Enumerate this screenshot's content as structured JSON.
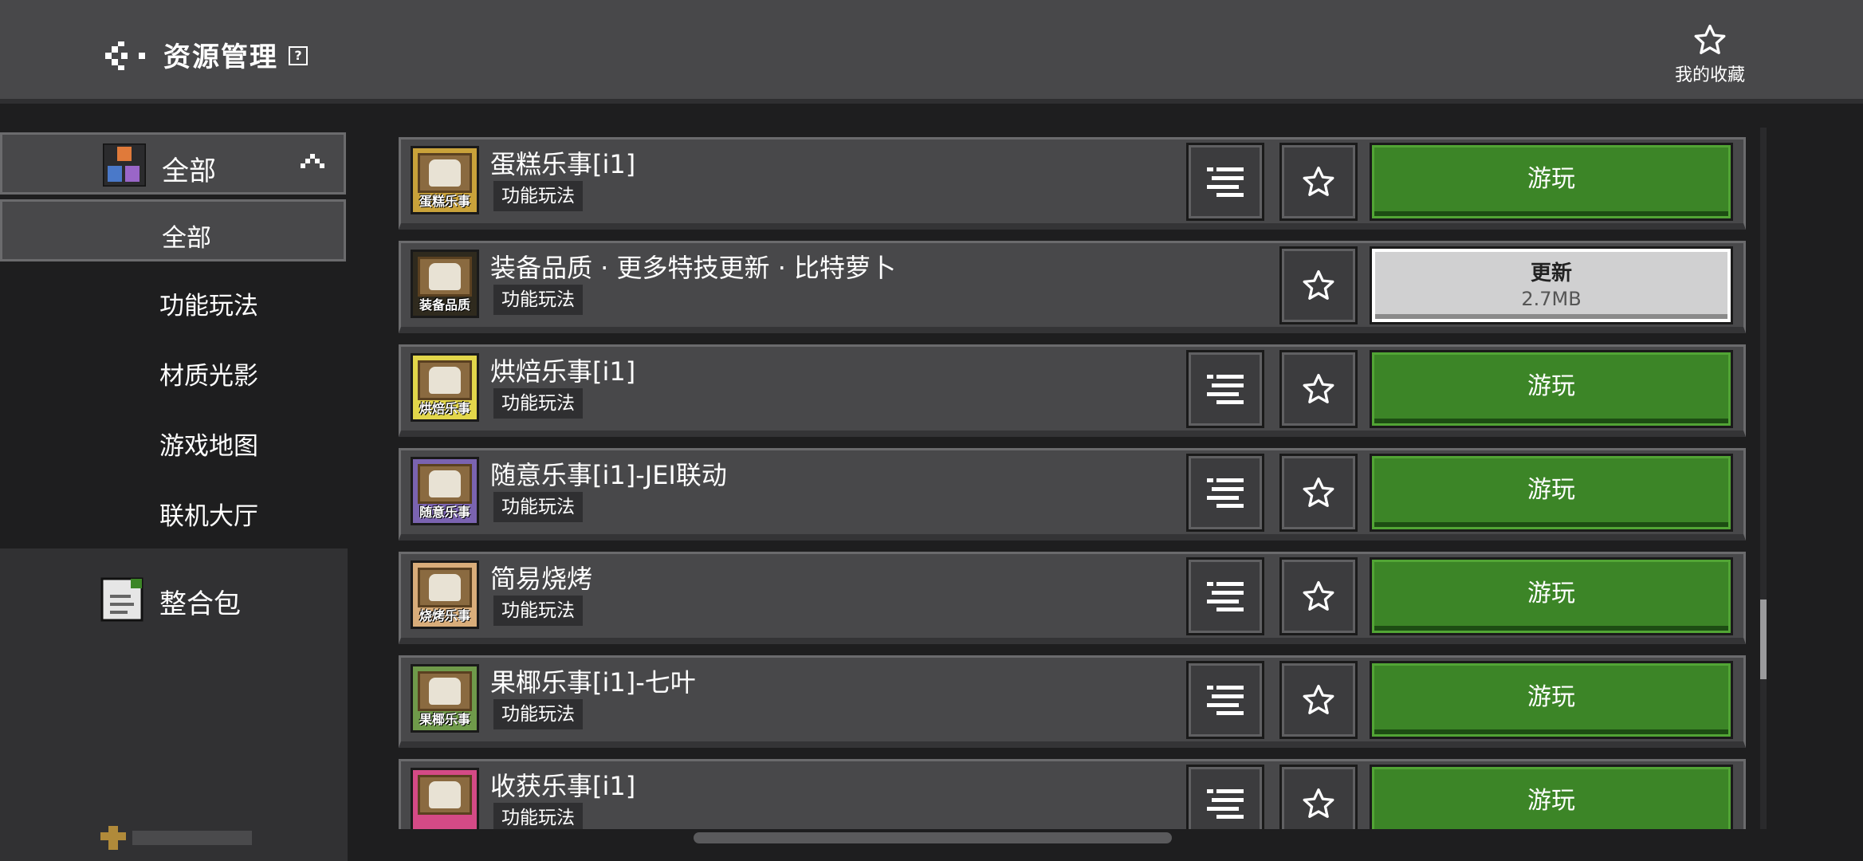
{
  "header": {
    "title": "资源管理",
    "help_symbol": "?",
    "favorites_label": "我的收藏"
  },
  "sidebar": {
    "category": "全部",
    "items": [
      {
        "label": "全部",
        "active": true
      },
      {
        "label": "功能玩法",
        "active": false
      },
      {
        "label": "材质光影",
        "active": false
      },
      {
        "label": "游戏地图",
        "active": false
      },
      {
        "label": "联机大厅",
        "active": false
      }
    ],
    "pack_label": "整合包"
  },
  "list": {
    "items": [
      {
        "title": "蛋糕乐事[i1]",
        "tag": "功能玩法",
        "thumb_caption": "蛋糕乐事",
        "action": "游玩",
        "has_menu": true,
        "thumb_color": "#c9a23a"
      },
      {
        "title": "装备品质 · 更多特技更新 · 比特萝卜",
        "tag": "功能玩法",
        "thumb_caption": "装备品质",
        "action": "更新",
        "action_sub": "2.7MB",
        "has_menu": false,
        "thumb_color": "#2f2a1e"
      },
      {
        "title": "烘焙乐事[i1]",
        "tag": "功能玩法",
        "thumb_caption": "烘焙乐事",
        "action": "游玩",
        "has_menu": true,
        "thumb_color": "#e2d64a"
      },
      {
        "title": "随意乐事[i1]-JEI联动",
        "tag": "功能玩法",
        "thumb_caption": "随意乐事",
        "action": "游玩",
        "has_menu": true,
        "thumb_color": "#7a63b0"
      },
      {
        "title": "简易烧烤",
        "tag": "功能玩法",
        "thumb_caption": "烧烤乐事",
        "action": "游玩",
        "has_menu": true,
        "thumb_color": "#d9ad7a"
      },
      {
        "title": "果椰乐事[i1]-七叶",
        "tag": "功能玩法",
        "thumb_caption": "果椰乐事",
        "action": "游玩",
        "has_menu": true,
        "thumb_color": "#6f9a4a"
      },
      {
        "title": "收获乐事[i1]",
        "tag": "功能玩法",
        "thumb_caption": "",
        "action": "游玩",
        "has_menu": true,
        "thumb_color": "#d44a86"
      }
    ]
  }
}
